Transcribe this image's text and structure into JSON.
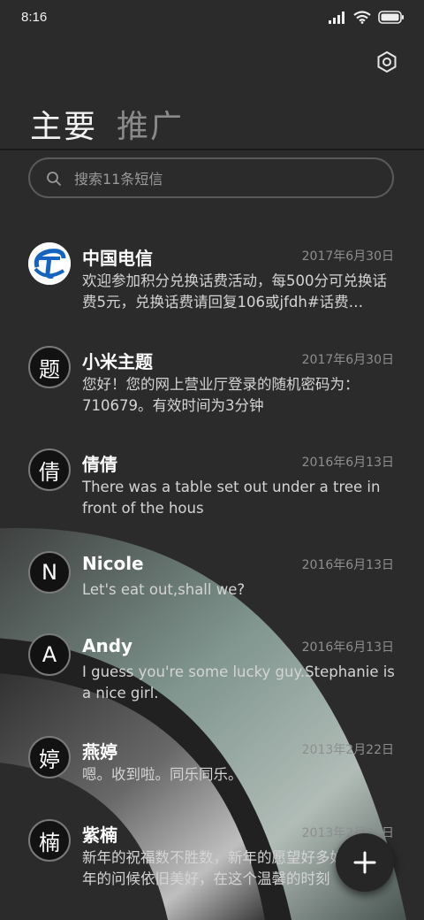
{
  "status_bar": {
    "time": "8:16"
  },
  "tabs": [
    {
      "label": "主要",
      "active": true
    },
    {
      "label": "推广",
      "active": false
    }
  ],
  "search": {
    "placeholder": "搜索11条短信"
  },
  "messages": [
    {
      "avatar": "",
      "avatar_icon": "china-telecom-logo-icon",
      "name": "中国电信",
      "date": "2017年6月30日",
      "preview": "欢迎参加积分兑换话费活动，每500分可兑换话费5元，兑换话费请回复106或jfdh#话费…"
    },
    {
      "avatar": "题",
      "name": "小米主题",
      "date": "2017年6月30日",
      "preview": "您好！您的网上营业厅登录的随机密码为：710679。有效时间为3分钟"
    },
    {
      "avatar": "倩",
      "name": "倩倩",
      "date": "2016年6月13日",
      "preview": "There was a table set out under a tree in front of the hous"
    },
    {
      "avatar": "N",
      "name": "Nicole",
      "date": "2016年6月13日",
      "preview": "Let's eat out,shall we?"
    },
    {
      "avatar": "A",
      "name": "Andy",
      "date": "2016年6月13日",
      "preview": "I guess you're some lucky guy.Stephanie is a nice girl."
    },
    {
      "avatar": "婷",
      "name": "燕婷",
      "date": "2013年2月22日",
      "preview": "嗯。收到啦。同乐同乐。"
    },
    {
      "avatar": "楠",
      "name": "紫楠",
      "date": "2013年2月22日",
      "preview": "新年的祝福数不胜数，新年的愿望好多好多，新年的问候依旧美好，在这个温馨的时刻"
    }
  ],
  "colors": {
    "background": "#2b2b2b",
    "accent_arc": "#8fa9a0",
    "telecom_blue": "#1565c0"
  },
  "icons": {
    "settings": "hexagon-settings-icon",
    "search": "search-icon",
    "fab": "plus-icon"
  }
}
